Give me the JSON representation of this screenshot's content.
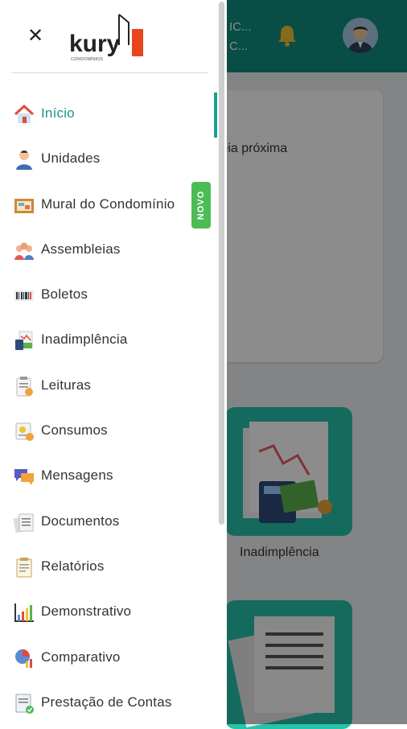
{
  "header": {
    "line1": "IC...",
    "line2": "C..."
  },
  "dashboard": {
    "card_text": "bleia próxima",
    "tile_label": "Inadimplência"
  },
  "drawer": {
    "logo_text": "kury",
    "logo_subtext": "CONDOMÍNIOS",
    "badge_new": "NOVO",
    "items": [
      {
        "label": "Início",
        "icon": "home-icon",
        "active": true
      },
      {
        "label": "Unidades",
        "icon": "person-icon"
      },
      {
        "label": "Mural do Condomínio",
        "icon": "noticeboard-icon"
      },
      {
        "label": "Assembleias",
        "icon": "group-icon"
      },
      {
        "label": "Boletos",
        "icon": "barcode-icon"
      },
      {
        "label": "Inadimplência",
        "icon": "debt-icon"
      },
      {
        "label": "Leituras",
        "icon": "clipboard-icon"
      },
      {
        "label": "Consumos",
        "icon": "consumption-icon"
      },
      {
        "label": "Mensagens",
        "icon": "chat-icon"
      },
      {
        "label": "Documentos",
        "icon": "documents-icon"
      },
      {
        "label": "Relatórios",
        "icon": "report-icon"
      },
      {
        "label": "Demonstrativo",
        "icon": "bar-chart-icon"
      },
      {
        "label": "Comparativo",
        "icon": "pie-chart-icon"
      },
      {
        "label": "Prestação de Contas",
        "icon": "accounts-icon"
      }
    ]
  },
  "colors": {
    "primary": "#0f8c80",
    "active_text": "#19978a",
    "badge": "#4cbc57",
    "tile": "#26c4aa"
  }
}
